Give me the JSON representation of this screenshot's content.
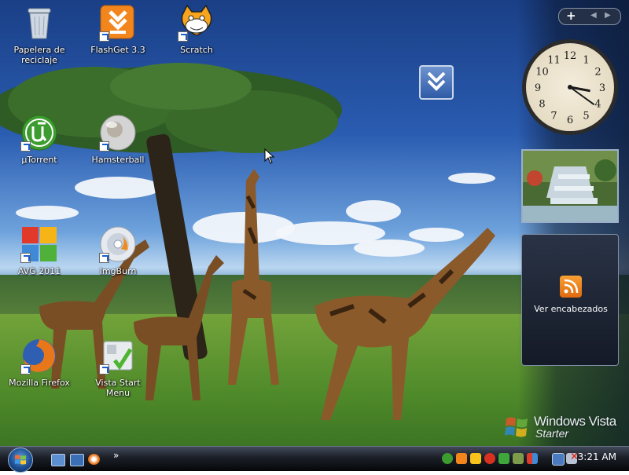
{
  "desktop": {
    "icons": [
      {
        "label": "Papelera de reciclaje",
        "icon": "recycle-bin-icon"
      },
      {
        "label": "FlashGet 3.3",
        "icon": "flashget-icon"
      },
      {
        "label": "Scratch",
        "icon": "scratch-cat-icon"
      },
      {
        "label": "µTorrent",
        "icon": "utorrent-icon"
      },
      {
        "label": "Hamsterball",
        "icon": "hamsterball-icon"
      },
      {
        "label": "AVG 2011",
        "icon": "avg-icon"
      },
      {
        "label": "ImgBurn",
        "icon": "imgburn-disc-icon"
      },
      {
        "label": "Mozilla Firefox",
        "icon": "firefox-icon"
      },
      {
        "label": "Vista Start Menu",
        "icon": "vista-start-menu-icon"
      }
    ]
  },
  "sidebar": {
    "feed_label": "Ver encabezados",
    "clock_numerals": [
      "12",
      "1",
      "2",
      "3",
      "4",
      "5",
      "6",
      "7",
      "8",
      "9",
      "10",
      "11"
    ],
    "clock_time": {
      "hour": 3,
      "minute": 21
    }
  },
  "watermark": {
    "line1": "Windows Vista",
    "line2": "Starter"
  },
  "taskbar": {
    "quicklaunch_more": "»",
    "clock": "3:21 AM"
  },
  "colors": {
    "taskbar": "#1b1f27",
    "rss": "#f08a1f",
    "utorrent": "#3d9c2f",
    "firefox": "#e8761b"
  }
}
